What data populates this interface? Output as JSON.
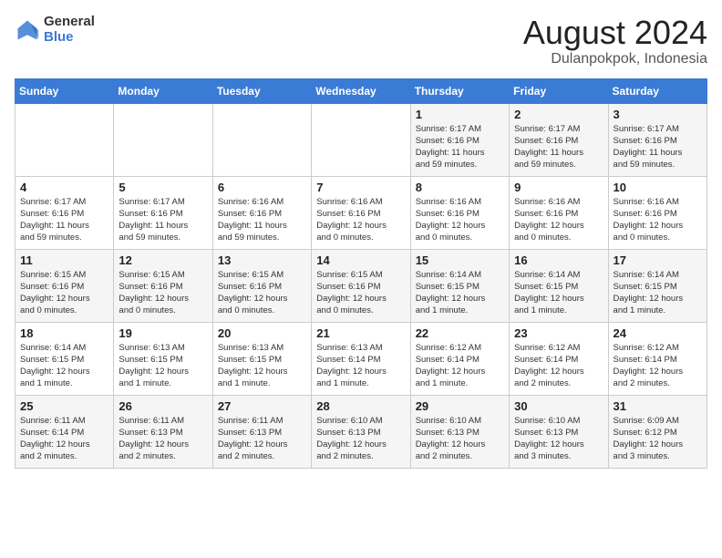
{
  "logo": {
    "line1": "General",
    "line2": "Blue"
  },
  "title": "August 2024",
  "subtitle": "Dulanpokpok, Indonesia",
  "days_of_week": [
    "Sunday",
    "Monday",
    "Tuesday",
    "Wednesday",
    "Thursday",
    "Friday",
    "Saturday"
  ],
  "weeks": [
    [
      {
        "num": "",
        "info": ""
      },
      {
        "num": "",
        "info": ""
      },
      {
        "num": "",
        "info": ""
      },
      {
        "num": "",
        "info": ""
      },
      {
        "num": "1",
        "info": "Sunrise: 6:17 AM\nSunset: 6:16 PM\nDaylight: 11 hours\nand 59 minutes."
      },
      {
        "num": "2",
        "info": "Sunrise: 6:17 AM\nSunset: 6:16 PM\nDaylight: 11 hours\nand 59 minutes."
      },
      {
        "num": "3",
        "info": "Sunrise: 6:17 AM\nSunset: 6:16 PM\nDaylight: 11 hours\nand 59 minutes."
      }
    ],
    [
      {
        "num": "4",
        "info": "Sunrise: 6:17 AM\nSunset: 6:16 PM\nDaylight: 11 hours\nand 59 minutes."
      },
      {
        "num": "5",
        "info": "Sunrise: 6:17 AM\nSunset: 6:16 PM\nDaylight: 11 hours\nand 59 minutes."
      },
      {
        "num": "6",
        "info": "Sunrise: 6:16 AM\nSunset: 6:16 PM\nDaylight: 11 hours\nand 59 minutes."
      },
      {
        "num": "7",
        "info": "Sunrise: 6:16 AM\nSunset: 6:16 PM\nDaylight: 12 hours\nand 0 minutes."
      },
      {
        "num": "8",
        "info": "Sunrise: 6:16 AM\nSunset: 6:16 PM\nDaylight: 12 hours\nand 0 minutes."
      },
      {
        "num": "9",
        "info": "Sunrise: 6:16 AM\nSunset: 6:16 PM\nDaylight: 12 hours\nand 0 minutes."
      },
      {
        "num": "10",
        "info": "Sunrise: 6:16 AM\nSunset: 6:16 PM\nDaylight: 12 hours\nand 0 minutes."
      }
    ],
    [
      {
        "num": "11",
        "info": "Sunrise: 6:15 AM\nSunset: 6:16 PM\nDaylight: 12 hours\nand 0 minutes."
      },
      {
        "num": "12",
        "info": "Sunrise: 6:15 AM\nSunset: 6:16 PM\nDaylight: 12 hours\nand 0 minutes."
      },
      {
        "num": "13",
        "info": "Sunrise: 6:15 AM\nSunset: 6:16 PM\nDaylight: 12 hours\nand 0 minutes."
      },
      {
        "num": "14",
        "info": "Sunrise: 6:15 AM\nSunset: 6:16 PM\nDaylight: 12 hours\nand 0 minutes."
      },
      {
        "num": "15",
        "info": "Sunrise: 6:14 AM\nSunset: 6:15 PM\nDaylight: 12 hours\nand 1 minute."
      },
      {
        "num": "16",
        "info": "Sunrise: 6:14 AM\nSunset: 6:15 PM\nDaylight: 12 hours\nand 1 minute."
      },
      {
        "num": "17",
        "info": "Sunrise: 6:14 AM\nSunset: 6:15 PM\nDaylight: 12 hours\nand 1 minute."
      }
    ],
    [
      {
        "num": "18",
        "info": "Sunrise: 6:14 AM\nSunset: 6:15 PM\nDaylight: 12 hours\nand 1 minute."
      },
      {
        "num": "19",
        "info": "Sunrise: 6:13 AM\nSunset: 6:15 PM\nDaylight: 12 hours\nand 1 minute."
      },
      {
        "num": "20",
        "info": "Sunrise: 6:13 AM\nSunset: 6:15 PM\nDaylight: 12 hours\nand 1 minute."
      },
      {
        "num": "21",
        "info": "Sunrise: 6:13 AM\nSunset: 6:14 PM\nDaylight: 12 hours\nand 1 minute."
      },
      {
        "num": "22",
        "info": "Sunrise: 6:12 AM\nSunset: 6:14 PM\nDaylight: 12 hours\nand 1 minute."
      },
      {
        "num": "23",
        "info": "Sunrise: 6:12 AM\nSunset: 6:14 PM\nDaylight: 12 hours\nand 2 minutes."
      },
      {
        "num": "24",
        "info": "Sunrise: 6:12 AM\nSunset: 6:14 PM\nDaylight: 12 hours\nand 2 minutes."
      }
    ],
    [
      {
        "num": "25",
        "info": "Sunrise: 6:11 AM\nSunset: 6:14 PM\nDaylight: 12 hours\nand 2 minutes."
      },
      {
        "num": "26",
        "info": "Sunrise: 6:11 AM\nSunset: 6:13 PM\nDaylight: 12 hours\nand 2 minutes."
      },
      {
        "num": "27",
        "info": "Sunrise: 6:11 AM\nSunset: 6:13 PM\nDaylight: 12 hours\nand 2 minutes."
      },
      {
        "num": "28",
        "info": "Sunrise: 6:10 AM\nSunset: 6:13 PM\nDaylight: 12 hours\nand 2 minutes."
      },
      {
        "num": "29",
        "info": "Sunrise: 6:10 AM\nSunset: 6:13 PM\nDaylight: 12 hours\nand 2 minutes."
      },
      {
        "num": "30",
        "info": "Sunrise: 6:10 AM\nSunset: 6:13 PM\nDaylight: 12 hours\nand 3 minutes."
      },
      {
        "num": "31",
        "info": "Sunrise: 6:09 AM\nSunset: 6:12 PM\nDaylight: 12 hours\nand 3 minutes."
      }
    ]
  ]
}
